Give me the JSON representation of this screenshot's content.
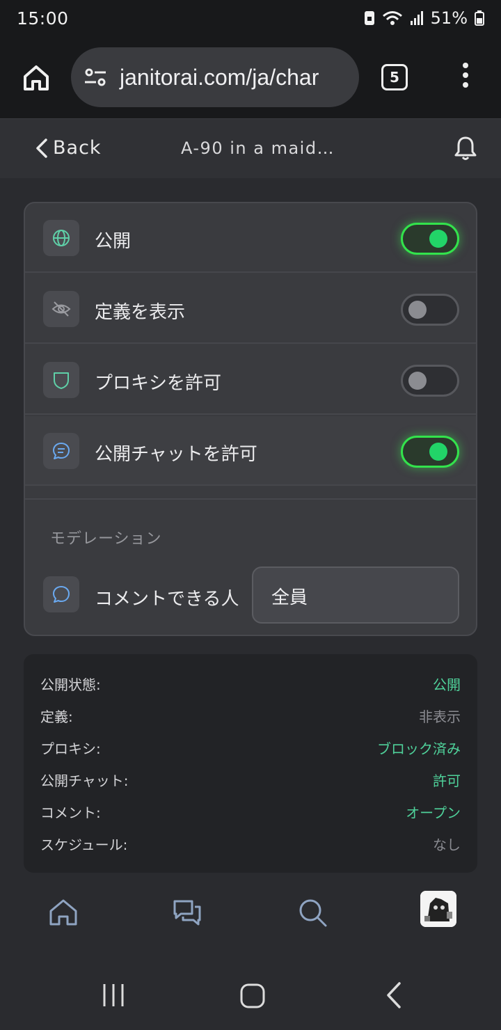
{
  "status": {
    "time": "15:00",
    "battery": "51%"
  },
  "browser": {
    "url": "janitorai.com/ja/char",
    "tab_count": "5"
  },
  "header": {
    "back_label": "Back",
    "title": "A-90 in a maid…"
  },
  "settings": {
    "rows": [
      {
        "label": "公開",
        "enabled": true,
        "icon": "globe-icon"
      },
      {
        "label": "定義を表示",
        "enabled": false,
        "icon": "eye-off-icon"
      },
      {
        "label": "プロキシを許可",
        "enabled": false,
        "icon": "shield-icon"
      },
      {
        "label": "公開チャットを許可",
        "enabled": true,
        "icon": "chat-icon"
      }
    ],
    "moderation_title": "モデレーション",
    "comment_label": "コメントできる人",
    "comment_value": "全員"
  },
  "summary": {
    "rows": [
      {
        "key": "公開状態:",
        "value": "公開",
        "accent": true
      },
      {
        "key": "定義:",
        "value": "非表示",
        "accent": false
      },
      {
        "key": "プロキシ:",
        "value": "ブロック済み",
        "accent": true
      },
      {
        "key": "公開チャット:",
        "value": "許可",
        "accent": true
      },
      {
        "key": "コメント:",
        "value": "オープン",
        "accent": true
      },
      {
        "key": "スケジュール:",
        "value": "なし",
        "accent": false
      }
    ]
  },
  "colors": {
    "accent_green": "#33e34c",
    "value_green": "#4fd19a",
    "background": "#2a2b2f"
  }
}
